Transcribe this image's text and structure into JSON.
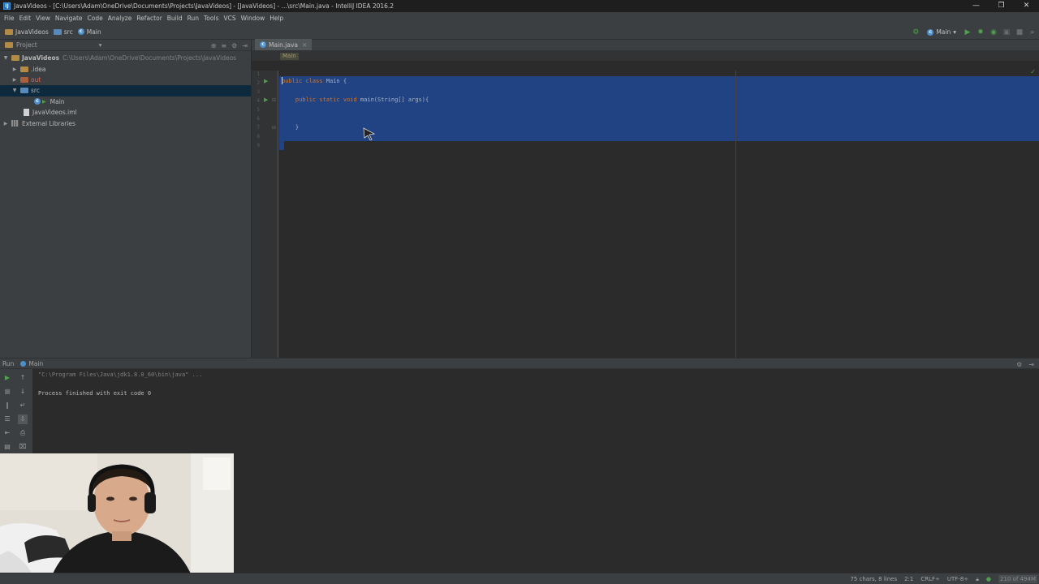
{
  "window": {
    "title": "JavaVideos - [C:\\Users\\Adam\\OneDrive\\Documents\\Projects\\JavaVideos] - [JavaVideos] - ...\\src\\Main.java - IntelliJ IDEA 2016.2",
    "controls": [
      "—",
      "❐",
      "✕"
    ]
  },
  "menu": [
    "File",
    "Edit",
    "View",
    "Navigate",
    "Code",
    "Analyze",
    "Refactor",
    "Build",
    "Run",
    "Tools",
    "VCS",
    "Window",
    "Help"
  ],
  "nav": {
    "breadcrumbs": [
      "JavaVideos",
      "src",
      "Main"
    ],
    "run_config": "Main"
  },
  "project": {
    "title": "Project",
    "tree": [
      {
        "label": "JavaVideos",
        "path": "C:\\Users\\Adam\\OneDrive\\Documents\\Projects\\JavaVideos"
      },
      {
        "label": ".idea"
      },
      {
        "label": "out"
      },
      {
        "label": "src"
      },
      {
        "label": "Main"
      },
      {
        "label": "JavaVideos.iml"
      },
      {
        "label": "External Libraries"
      }
    ]
  },
  "editor": {
    "tab": "Main.java",
    "breadcrumb_chip": "Main",
    "line_numbers": [
      "1",
      "2",
      "3",
      "4",
      "5",
      "6",
      "7",
      "8",
      "9"
    ],
    "code": {
      "line2_kw": "public class",
      "line2_rest": " Main {",
      "line4_kw": "    public static void",
      "line4_rest": " main(String[] args){",
      "line7": "    }"
    }
  },
  "run": {
    "title": "Run",
    "config": "Main",
    "console": {
      "command": "\"C:\\Program Files\\Java\\jdk1.8.0_60\\bin\\java\" ...",
      "result": "Process finished with exit code 0"
    }
  },
  "status": {
    "chars": "75 chars, 8 lines",
    "position": "2:1",
    "line_sep": "CRLF÷",
    "encoding": "UTF-8÷",
    "memory": "210 of 494M"
  },
  "colors": {
    "selection": "#214283",
    "keyword": "#cc7832",
    "run_green": "#4e9a4e"
  },
  "icons": [
    "app-icon",
    "folder-icon",
    "class-icon",
    "run-icon",
    "debug-icon",
    "gear-icon",
    "stop-icon",
    "rerun-icon"
  ]
}
